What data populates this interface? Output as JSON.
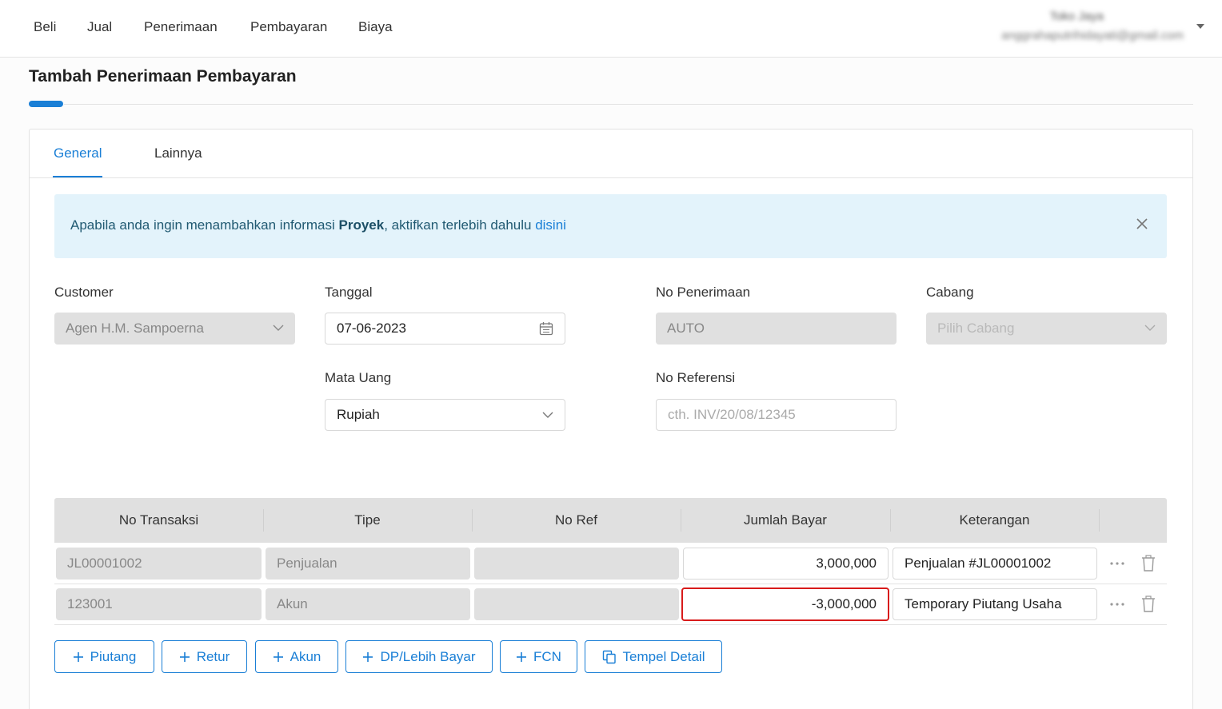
{
  "nav": {
    "items": [
      {
        "label": "Beli"
      },
      {
        "label": "Jual"
      },
      {
        "label": "Penerimaan"
      },
      {
        "label": "Pembayaran"
      },
      {
        "label": "Biaya"
      }
    ],
    "user_name": "Toko Jaya",
    "user_email": "anggrahaputrihidayati@gmail.com"
  },
  "page": {
    "title": "Tambah Penerimaan Pembayaran"
  },
  "tabs": [
    {
      "label": "General"
    },
    {
      "label": "Lainnya"
    }
  ],
  "alert": {
    "text_before": "Apabila anda ingin menambahkan informasi ",
    "bold": "Proyek",
    "text_after": ", aktifkan terlebih dahulu ",
    "link": "disini"
  },
  "form": {
    "customer": {
      "label": "Customer",
      "value": "Agen H.M. Sampoerna"
    },
    "tanggal": {
      "label": "Tanggal",
      "value": "07-06-2023"
    },
    "no_penerimaan": {
      "label": "No Penerimaan",
      "value": "AUTO"
    },
    "cabang": {
      "label": "Cabang",
      "placeholder": "Pilih Cabang"
    },
    "mata_uang": {
      "label": "Mata Uang",
      "value": "Rupiah"
    },
    "no_referensi": {
      "label": "No Referensi",
      "placeholder": "cth. INV/20/08/12345"
    }
  },
  "table": {
    "headers": [
      "No Transaksi",
      "Tipe",
      "No Ref",
      "Jumlah Bayar",
      "Keterangan"
    ],
    "rows": [
      {
        "no_transaksi": "JL00001002",
        "tipe": "Penjualan",
        "no_ref": "",
        "jumlah_bayar": "3,000,000",
        "keterangan": "Penjualan #JL00001002"
      },
      {
        "no_transaksi": "123001",
        "tipe": "Akun",
        "no_ref": "",
        "jumlah_bayar": "-3,000,000",
        "keterangan": "Temporary Piutang Usaha"
      }
    ]
  },
  "buttons": {
    "piutang": "Piutang",
    "retur": "Retur",
    "akun": "Akun",
    "dp": "DP/Lebih Bayar",
    "fcn": "FCN",
    "tempel": "Tempel Detail"
  },
  "colors": {
    "accent": "#1a7fd6",
    "error": "#d81b1b",
    "alert_bg": "#e3f3fb"
  }
}
